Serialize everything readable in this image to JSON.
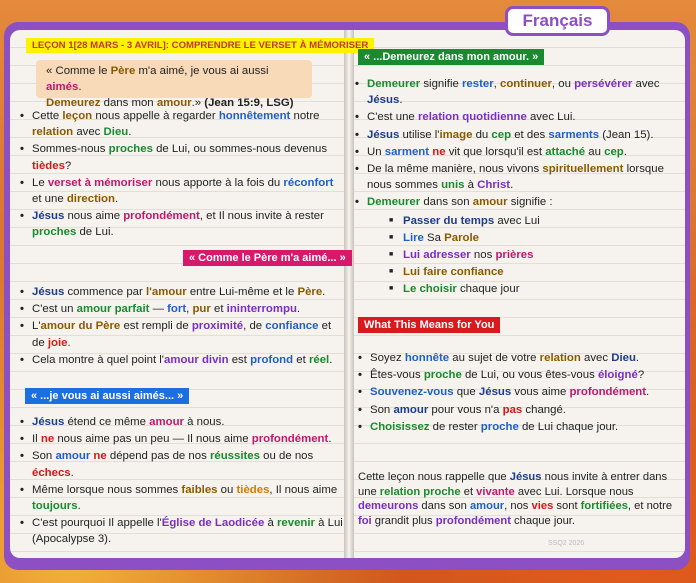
{
  "tab": "Français",
  "left": {
    "lesson_title": "LEÇON 1[28 MARS - 3 AVRIL]: COMPRENDRE LE VERSET À MÉMORISER",
    "quote": {
      "t1": "« Comme le ",
      "t2": "Père",
      "t3": " m'a aimé, je vous ai aussi ",
      "t4": "aimés",
      "t5": ".",
      "t6": "Demeurez",
      "t7": " dans mon ",
      "t8": "amour",
      "t9": ".» ",
      "t10": "(Jean 15:9, LSG)"
    },
    "intro": [
      {
        "a": "Cette ",
        "b": "leçon",
        "c": " nous appelle à regarder ",
        "d": "honnêtement",
        "e": " notre ",
        "f": "relation",
        "g": " avec ",
        "h": "Dieu",
        "i": "."
      },
      {
        "a": "Sommes-nous ",
        "b": "proches",
        "c": " de Lui, ou sommes-nous devenus ",
        "d": "tièdes",
        "e": "?"
      },
      {
        "a": "Le ",
        "b": "verset à mémoriser",
        "c": " nous apporte à la fois du ",
        "d": "réconfort",
        "e": " et une ",
        "f": "direction",
        "g": "."
      },
      {
        "a": "Jésus",
        "b": " nous aime ",
        "c": "profondément",
        "d": ", et Il nous invite à rester ",
        "e": "proches",
        "f": " de Lui."
      }
    ],
    "h2": "« Comme le Père m'a aimé... »",
    "list2": [
      {
        "a": "Jésus",
        "b": " commence par ",
        "c": "l'amour",
        "d": " entre Lui-même et le ",
        "e": "Père",
        "f": "."
      },
      {
        "a": "C'est un ",
        "b": "amour parfait",
        "c": " — ",
        "d": "fort",
        "e": ", ",
        "f": "pur",
        "g": " et ",
        "h": "ininterrompu",
        "i": "."
      },
      {
        "a": "L'",
        "b": "amour du Père",
        "c": " est rempli de ",
        "d": "proximité",
        "e": ", de ",
        "f": "confiance",
        "g": " et de ",
        "h": "joie",
        "i": "."
      },
      {
        "a": "Cela montre à quel point l'",
        "b": "amour divin",
        "c": " est ",
        "d": "profond",
        "e": " et ",
        "f": "réel",
        "g": "."
      }
    ],
    "h3": "« ...je vous ai aussi aimés... »",
    "list3": [
      {
        "a": "Jésus",
        "b": " étend ce même ",
        "c": "amour",
        "d": " à nous."
      },
      {
        "a": "Il ",
        "b": "ne",
        "c": " nous aime pas un peu — Il nous aime ",
        "d": "profondément",
        "e": "."
      },
      {
        "a": "Son ",
        "b": "amour",
        "c": " ",
        "d": "ne",
        "e": " dépend pas de nos ",
        "f": "réussites",
        "g": " ou de nos ",
        "h": "échecs",
        "i": "."
      },
      {
        "a": "Même lorsque nous sommes ",
        "b": "faibles",
        "c": " ou ",
        "d": "tièdes",
        "e": ", Il nous aime ",
        "f": "toujours",
        "g": "."
      },
      {
        "a": "C'est pourquoi Il appelle l'",
        "b": "Église de Laodicée",
        "c": " à ",
        "d": "revenir",
        "e": " à Lui (Apocalypse 3)."
      }
    ]
  },
  "right": {
    "h1": "« ...Demeurez dans mon amour. »",
    "list1": [
      {
        "a": "Demeurer",
        "b": " signifie ",
        "c": "rester",
        "d": ", ",
        "e": "continuer",
        "f": ", ou ",
        "g": "persévérer",
        "h": " avec ",
        "i": "Jésus",
        "j": "."
      },
      {
        "a": "C'est une ",
        "b": "relation quotidienne",
        "c": " avec Lui."
      },
      {
        "a": "Jésus",
        "b": " utilise l'",
        "c": "image",
        "d": " du ",
        "e": "cep",
        "f": " et des ",
        "g": "sarments",
        "h": " (Jean 15)."
      },
      {
        "a": "Un ",
        "b": "sarment",
        "c": " ",
        "d": "ne",
        "e": " vit que lorsqu'il est ",
        "f": "attaché",
        "g": " au ",
        "h": "cep",
        "i": "."
      },
      {
        "a": "De la même manière, nous vivons ",
        "b": "spirituellement",
        "c": " lorsque nous sommes ",
        "d": "unis",
        "e": " à ",
        "f": "Christ",
        "g": "."
      },
      {
        "a": "Demeurer",
        "b": " dans son ",
        "c": "amour",
        "d": " signifie :"
      }
    ],
    "sub": [
      {
        "a": "Passer du temps",
        "b": " avec Lui"
      },
      {
        "a": "Lire",
        "b": " Sa ",
        "c": "Parole"
      },
      {
        "a": "Lui adresser",
        "b": " nos ",
        "c": "prières"
      },
      {
        "a": "Lui faire confiance",
        "b": ""
      },
      {
        "a": "Le choisir",
        "b": " chaque jour"
      }
    ],
    "h2": "What This Means for You",
    "list2": [
      {
        "a": "Soyez ",
        "b": "honnête",
        "c": " au sujet de votre ",
        "d": "relation",
        "e": " avec ",
        "f": "Dieu",
        "g": "."
      },
      {
        "a": "Êtes-vous ",
        "b": "proche",
        "c": " de Lui, ou vous êtes-vous ",
        "d": "éloigné",
        "e": "?"
      },
      {
        "a": "Souvenez-vous",
        "b": " que ",
        "c": "Jésus",
        "d": " vous aime ",
        "e": "profondément",
        "f": "."
      },
      {
        "a": "Son ",
        "b": "amour",
        "c": " pour vous n'a ",
        "d": "pas",
        "e": " changé."
      },
      {
        "a": "Choisissez",
        "b": " de rester ",
        "c": "proche",
        "d": " de Lui chaque jour."
      }
    ],
    "closing": {
      "a": "Cette leçon nous rappelle que ",
      "b": "Jésus",
      "c": " nous invite à entrer dans une ",
      "d": "relation proche",
      "e": " et ",
      "f": "vivante",
      "g": " avec Lui. Lorsque nous ",
      "h": "demeurons",
      "i": " dans son ",
      "j": "amour",
      "k": ", nos ",
      "l": "vies",
      "m": " sont ",
      "n": "fortifiées",
      "o": ", et notre ",
      "p": "foi",
      "q": " grandit plus ",
      "r": "profondément",
      "s": " chaque jour."
    },
    "footer": "SSQ2 2026"
  }
}
